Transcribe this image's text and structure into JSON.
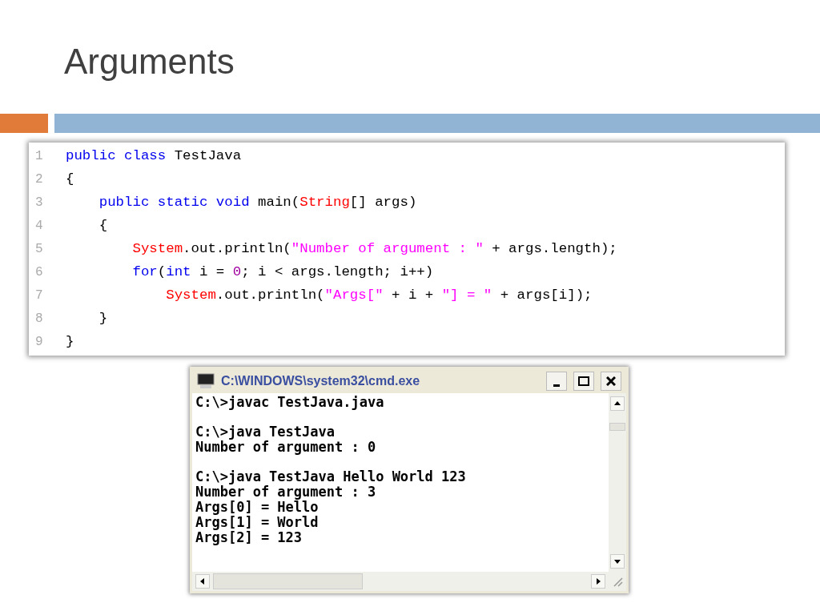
{
  "slide": {
    "title": "Arguments"
  },
  "code": {
    "lines": [
      {
        "number": "1",
        "tokens": [
          {
            "kind": "keyword",
            "text": "public class"
          },
          {
            "kind": "plain",
            "text": " TestJava"
          }
        ]
      },
      {
        "number": "2",
        "tokens": [
          {
            "kind": "plain",
            "text": "{"
          }
        ]
      },
      {
        "number": "3",
        "tokens": [
          {
            "kind": "keyword",
            "text": "    public static void"
          },
          {
            "kind": "plain",
            "text": " main("
          },
          {
            "kind": "type",
            "text": "String"
          },
          {
            "kind": "plain",
            "text": "[] args)"
          }
        ]
      },
      {
        "number": "4",
        "tokens": [
          {
            "kind": "plain",
            "text": "    {"
          }
        ]
      },
      {
        "number": "5",
        "tokens": [
          {
            "kind": "type",
            "text": "        System"
          },
          {
            "kind": "plain",
            "text": ".out.println("
          },
          {
            "kind": "string",
            "text": "\"Number of argument : \""
          },
          {
            "kind": "plain",
            "text": " + args.length);"
          }
        ]
      },
      {
        "number": "6",
        "tokens": [
          {
            "kind": "keyword",
            "text": "        for"
          },
          {
            "kind": "plain",
            "text": "("
          },
          {
            "kind": "keyword",
            "text": "int"
          },
          {
            "kind": "plain",
            "text": " i = "
          },
          {
            "kind": "number",
            "text": "0"
          },
          {
            "kind": "plain",
            "text": "; i < args.length; i++)"
          }
        ]
      },
      {
        "number": "7",
        "tokens": [
          {
            "kind": "type",
            "text": "            System"
          },
          {
            "kind": "plain",
            "text": ".out.println("
          },
          {
            "kind": "string",
            "text": "\"Args[\""
          },
          {
            "kind": "plain",
            "text": " + i + "
          },
          {
            "kind": "string",
            "text": "\"] = \""
          },
          {
            "kind": "plain",
            "text": " + args[i]);"
          }
        ]
      },
      {
        "number": "8",
        "tokens": [
          {
            "kind": "plain",
            "text": "    }"
          }
        ]
      },
      {
        "number": "9",
        "tokens": [
          {
            "kind": "plain",
            "text": "}"
          }
        ]
      }
    ]
  },
  "console": {
    "title": "C:\\WINDOWS\\system32\\cmd.exe",
    "blocks": [
      [
        "C:\\>javac TestJava.java"
      ],
      [
        "C:\\>java TestJava",
        "Number of argument : 0"
      ],
      [
        "C:\\>java TestJava Hello World 123",
        "Number of argument : 3",
        "Args[0] = Hello",
        "Args[1] = World",
        "Args[2] = 123"
      ]
    ]
  }
}
